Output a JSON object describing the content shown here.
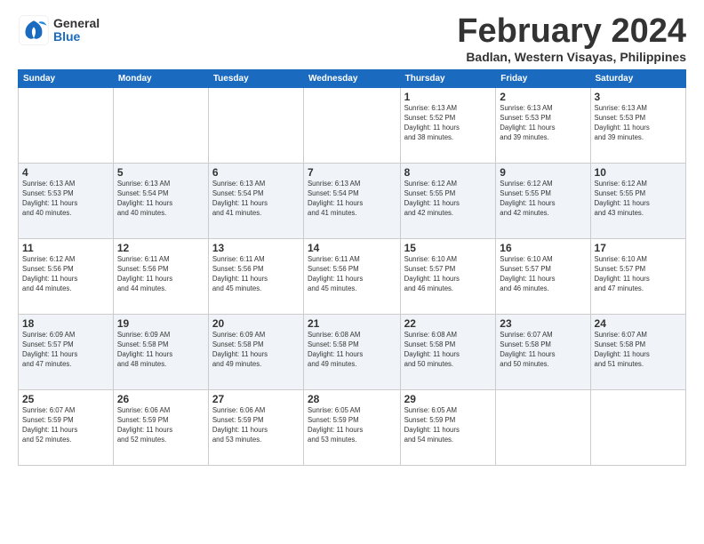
{
  "header": {
    "logo_general": "General",
    "logo_blue": "Blue",
    "month_title": "February 2024",
    "subtitle": "Badlan, Western Visayas, Philippines"
  },
  "days_of_week": [
    "Sunday",
    "Monday",
    "Tuesday",
    "Wednesday",
    "Thursday",
    "Friday",
    "Saturday"
  ],
  "weeks": [
    {
      "row_class": "row1",
      "days": [
        {
          "num": "",
          "info": ""
        },
        {
          "num": "",
          "info": ""
        },
        {
          "num": "",
          "info": ""
        },
        {
          "num": "",
          "info": ""
        },
        {
          "num": "1",
          "info": "Sunrise: 6:13 AM\nSunset: 5:52 PM\nDaylight: 11 hours\nand 38 minutes."
        },
        {
          "num": "2",
          "info": "Sunrise: 6:13 AM\nSunset: 5:53 PM\nDaylight: 11 hours\nand 39 minutes."
        },
        {
          "num": "3",
          "info": "Sunrise: 6:13 AM\nSunset: 5:53 PM\nDaylight: 11 hours\nand 39 minutes."
        }
      ]
    },
    {
      "row_class": "row2",
      "days": [
        {
          "num": "4",
          "info": "Sunrise: 6:13 AM\nSunset: 5:53 PM\nDaylight: 11 hours\nand 40 minutes."
        },
        {
          "num": "5",
          "info": "Sunrise: 6:13 AM\nSunset: 5:54 PM\nDaylight: 11 hours\nand 40 minutes."
        },
        {
          "num": "6",
          "info": "Sunrise: 6:13 AM\nSunset: 5:54 PM\nDaylight: 11 hours\nand 41 minutes."
        },
        {
          "num": "7",
          "info": "Sunrise: 6:13 AM\nSunset: 5:54 PM\nDaylight: 11 hours\nand 41 minutes."
        },
        {
          "num": "8",
          "info": "Sunrise: 6:12 AM\nSunset: 5:55 PM\nDaylight: 11 hours\nand 42 minutes."
        },
        {
          "num": "9",
          "info": "Sunrise: 6:12 AM\nSunset: 5:55 PM\nDaylight: 11 hours\nand 42 minutes."
        },
        {
          "num": "10",
          "info": "Sunrise: 6:12 AM\nSunset: 5:55 PM\nDaylight: 11 hours\nand 43 minutes."
        }
      ]
    },
    {
      "row_class": "row3",
      "days": [
        {
          "num": "11",
          "info": "Sunrise: 6:12 AM\nSunset: 5:56 PM\nDaylight: 11 hours\nand 44 minutes."
        },
        {
          "num": "12",
          "info": "Sunrise: 6:11 AM\nSunset: 5:56 PM\nDaylight: 11 hours\nand 44 minutes."
        },
        {
          "num": "13",
          "info": "Sunrise: 6:11 AM\nSunset: 5:56 PM\nDaylight: 11 hours\nand 45 minutes."
        },
        {
          "num": "14",
          "info": "Sunrise: 6:11 AM\nSunset: 5:56 PM\nDaylight: 11 hours\nand 45 minutes."
        },
        {
          "num": "15",
          "info": "Sunrise: 6:10 AM\nSunset: 5:57 PM\nDaylight: 11 hours\nand 46 minutes."
        },
        {
          "num": "16",
          "info": "Sunrise: 6:10 AM\nSunset: 5:57 PM\nDaylight: 11 hours\nand 46 minutes."
        },
        {
          "num": "17",
          "info": "Sunrise: 6:10 AM\nSunset: 5:57 PM\nDaylight: 11 hours\nand 47 minutes."
        }
      ]
    },
    {
      "row_class": "row4",
      "days": [
        {
          "num": "18",
          "info": "Sunrise: 6:09 AM\nSunset: 5:57 PM\nDaylight: 11 hours\nand 47 minutes."
        },
        {
          "num": "19",
          "info": "Sunrise: 6:09 AM\nSunset: 5:58 PM\nDaylight: 11 hours\nand 48 minutes."
        },
        {
          "num": "20",
          "info": "Sunrise: 6:09 AM\nSunset: 5:58 PM\nDaylight: 11 hours\nand 49 minutes."
        },
        {
          "num": "21",
          "info": "Sunrise: 6:08 AM\nSunset: 5:58 PM\nDaylight: 11 hours\nand 49 minutes."
        },
        {
          "num": "22",
          "info": "Sunrise: 6:08 AM\nSunset: 5:58 PM\nDaylight: 11 hours\nand 50 minutes."
        },
        {
          "num": "23",
          "info": "Sunrise: 6:07 AM\nSunset: 5:58 PM\nDaylight: 11 hours\nand 50 minutes."
        },
        {
          "num": "24",
          "info": "Sunrise: 6:07 AM\nSunset: 5:58 PM\nDaylight: 11 hours\nand 51 minutes."
        }
      ]
    },
    {
      "row_class": "row5",
      "days": [
        {
          "num": "25",
          "info": "Sunrise: 6:07 AM\nSunset: 5:59 PM\nDaylight: 11 hours\nand 52 minutes."
        },
        {
          "num": "26",
          "info": "Sunrise: 6:06 AM\nSunset: 5:59 PM\nDaylight: 11 hours\nand 52 minutes."
        },
        {
          "num": "27",
          "info": "Sunrise: 6:06 AM\nSunset: 5:59 PM\nDaylight: 11 hours\nand 53 minutes."
        },
        {
          "num": "28",
          "info": "Sunrise: 6:05 AM\nSunset: 5:59 PM\nDaylight: 11 hours\nand 53 minutes."
        },
        {
          "num": "29",
          "info": "Sunrise: 6:05 AM\nSunset: 5:59 PM\nDaylight: 11 hours\nand 54 minutes."
        },
        {
          "num": "",
          "info": ""
        },
        {
          "num": "",
          "info": ""
        }
      ]
    }
  ]
}
